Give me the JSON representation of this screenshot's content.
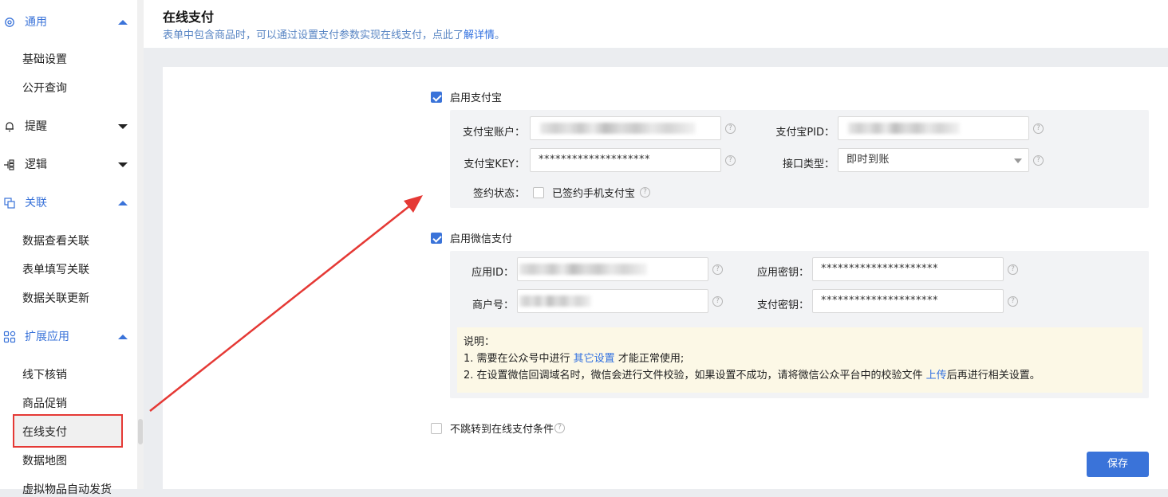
{
  "sidebar": {
    "groups": [
      {
        "label": "通用",
        "icon": "gear-icon",
        "state": "expanded"
      },
      {
        "label": "提醒",
        "icon": "bell-icon",
        "state": "collapsed"
      },
      {
        "label": "逻辑",
        "icon": "logic-flow-icon",
        "state": "collapsed"
      },
      {
        "label": "关联",
        "icon": "link-copy-icon",
        "state": "expanded"
      },
      {
        "label": "扩展应用",
        "icon": "apps-grid-icon",
        "state": "expanded"
      }
    ],
    "items": [
      "基础设置",
      "公开查询",
      "数据查看关联",
      "表单填写关联",
      "数据关联更新",
      "线下核销",
      "商品促销",
      "在线支付",
      "数据地图",
      "虚拟物品自动发货"
    ],
    "active_item": "在线支付"
  },
  "header": {
    "title": "在线支付",
    "desc_prefix": "表单中包含商品时，可以通过设置支付参数实现在线支付，点此了",
    "desc_link": "解详情",
    "desc_suffix": "。"
  },
  "alipay": {
    "enable_label": "启用支付宝",
    "enabled": true,
    "account_label": "支付宝账户：",
    "pid_label": "支付宝PID：",
    "key_label": "支付宝KEY：",
    "key_value": "********************",
    "api_type_label": "接口类型：",
    "api_type_value": "即时到账",
    "sign_status_label": "签约状态：",
    "sign_checkbox_label": "已签约手机支付宝",
    "sign_checked": false
  },
  "wechat": {
    "enable_label": "启用微信支付",
    "enabled": true,
    "app_id_label": "应用ID：",
    "app_secret_label": "应用密钥：",
    "app_secret_value": "*********************",
    "merchant_label": "商户号：",
    "pay_key_label": "支付密钥：",
    "pay_key_value": "*********************",
    "note_title": "说明：",
    "note_line1_prefix": "1. 需要在公众号中进行 ",
    "note_line1_link": "其它设置",
    "note_line1_suffix": " 才能正常使用;",
    "note_line2_prefix": "2. 在设置微信回调域名时，微信会进行文件校验，如果设置不成功，请将微信公众平台中的校验文件 ",
    "note_line2_link": "上传",
    "note_line2_suffix": "后再进行相关设置。"
  },
  "no_redirect": {
    "label": "不跳转到在线支付条件",
    "checked": false
  },
  "save_label": "保存",
  "colors": {
    "accent": "#3a73d9",
    "annotation_red": "#e53935",
    "note_bg": "#fcf8e6"
  }
}
